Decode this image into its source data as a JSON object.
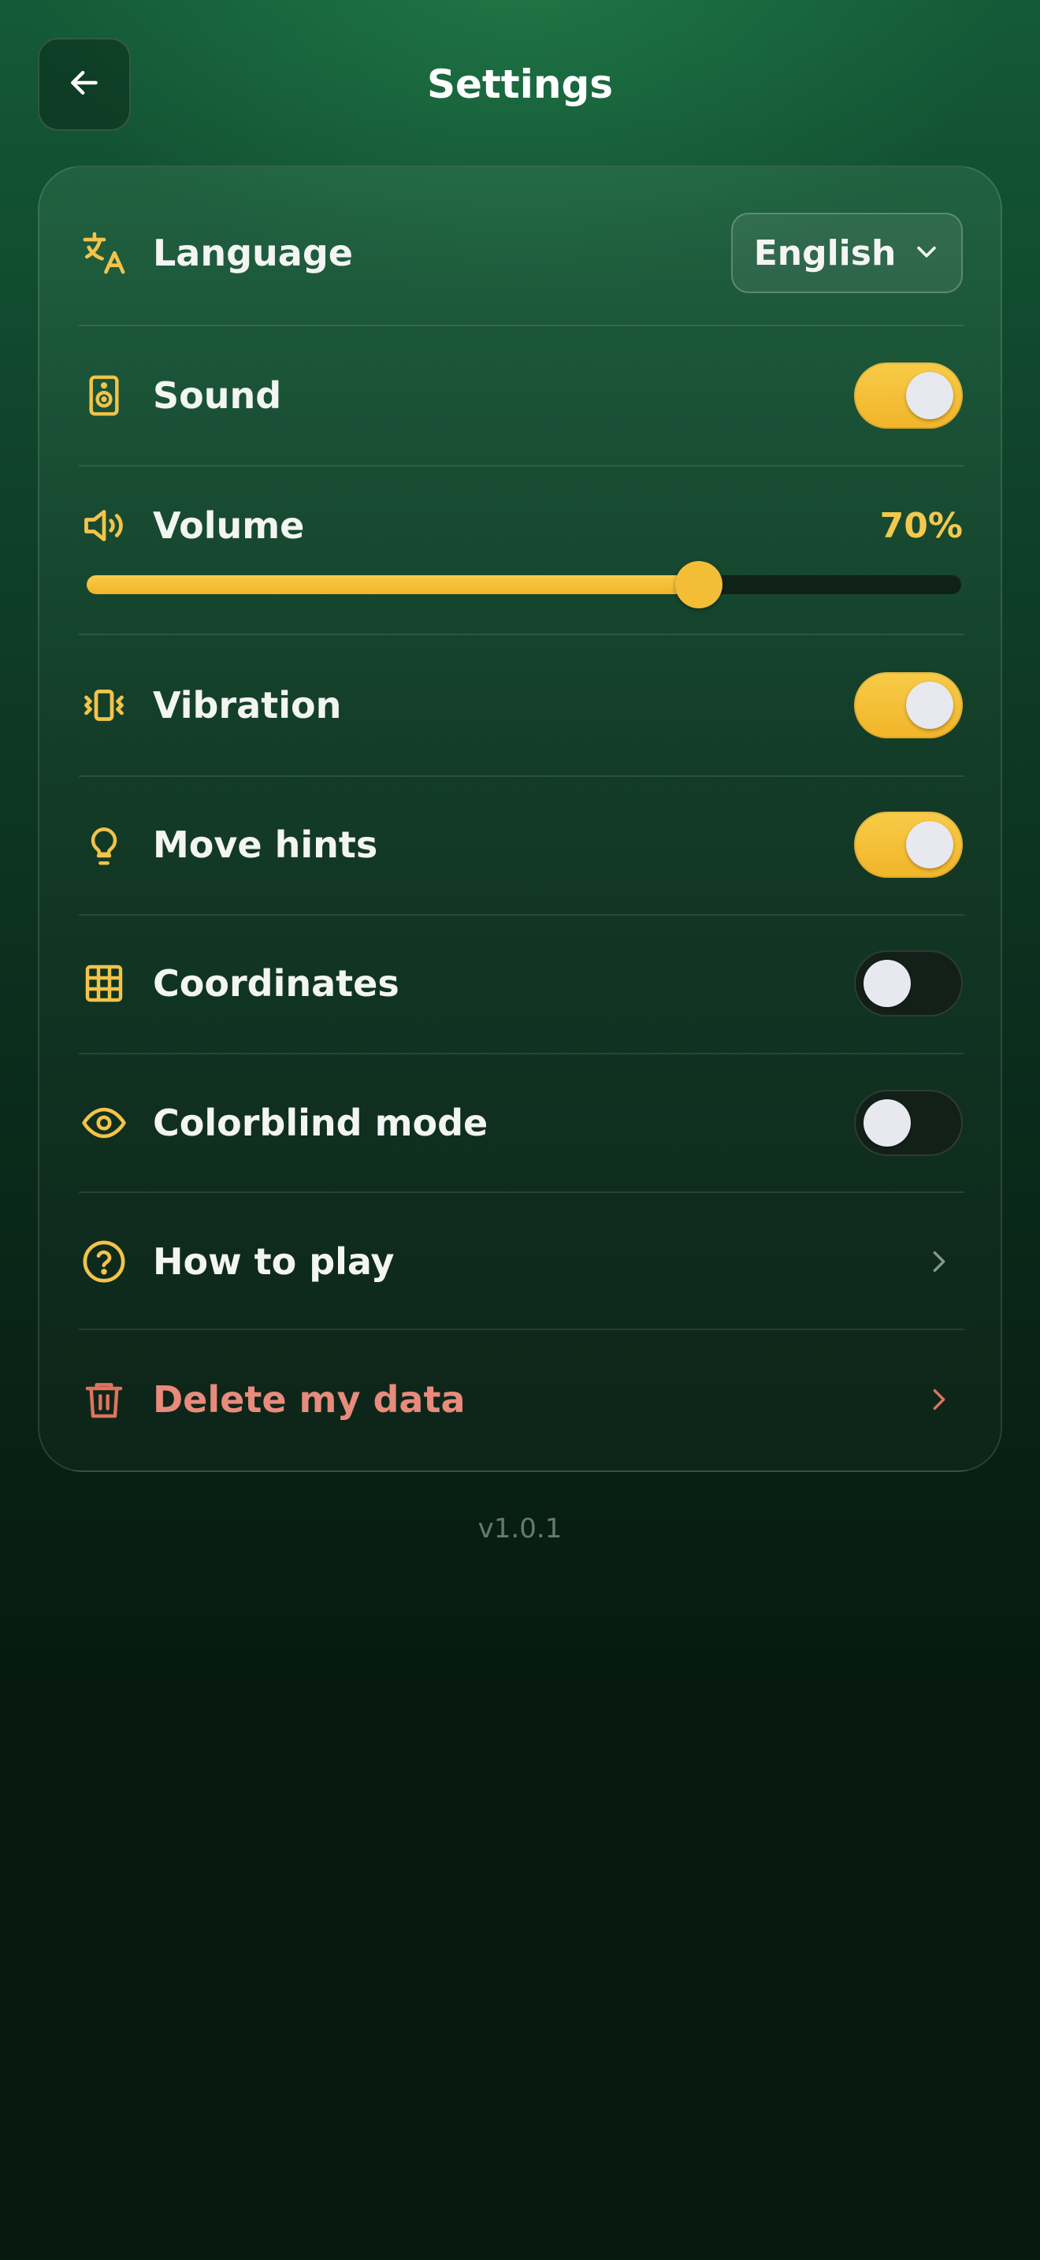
{
  "header": {
    "title": "Settings"
  },
  "colors": {
    "accent": "#f3c34a",
    "danger": "#e0725f"
  },
  "settings": {
    "language": {
      "label": "Language",
      "icon": "translate-icon",
      "selected": "English"
    },
    "sound": {
      "label": "Sound",
      "icon": "speaker-icon",
      "on": true
    },
    "volume": {
      "label": "Volume",
      "icon": "volume-icon",
      "value_text": "70%",
      "value": 70
    },
    "vibration": {
      "label": "Vibration",
      "icon": "vibration-icon",
      "on": true
    },
    "move_hints": {
      "label": "Move hints",
      "icon": "lightbulb-icon",
      "on": true
    },
    "coordinates": {
      "label": "Coordinates",
      "icon": "grid-icon",
      "on": false
    },
    "colorblind": {
      "label": "Colorblind mode",
      "icon": "eye-icon",
      "on": false
    },
    "how_to_play": {
      "label": "How to play",
      "icon": "help-circle-icon"
    },
    "delete_data": {
      "label": "Delete my data",
      "icon": "trash-icon"
    }
  },
  "footer": {
    "version": "v1.0.1"
  }
}
